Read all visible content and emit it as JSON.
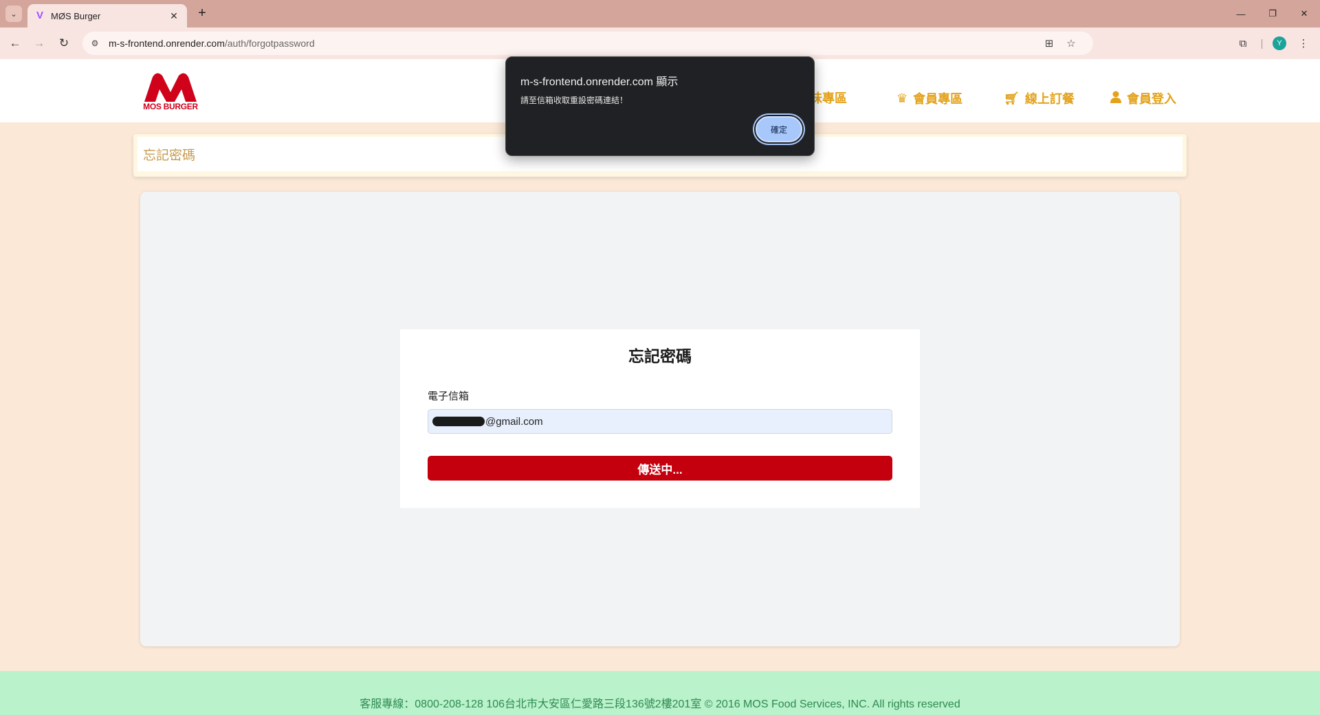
{
  "browser": {
    "tab_title": "MØS Burger",
    "new_tab": "+",
    "url_host": "m-s-frontend.onrender.com",
    "url_path": "/auth/forgotpassword",
    "profile_initial": "Y"
  },
  "site": {
    "logo_text": "MOS BURGER",
    "brand_color": "#d0021b",
    "accent_color": "#e3a21a",
    "nav": [
      {
        "label": "美味專區",
        "icon": "burger-icon"
      },
      {
        "label": "會員專區",
        "icon": "crown-icon"
      },
      {
        "label": "線上訂餐",
        "icon": "cart-icon"
      },
      {
        "label": "會員登入",
        "icon": "user-icon"
      }
    ]
  },
  "page": {
    "section_title": "忘記密碼",
    "form": {
      "title": "忘記密碼",
      "email_label": "電子信箱",
      "email_value_visible": "@gmail.com",
      "submit_label": "傳送中..."
    }
  },
  "footer": {
    "text": "客服專線：0800-208-128 106台北市大安區仁愛路三段136號2樓201室 © 2016 MOS Food Services, INC. All rights reserved"
  },
  "dialog": {
    "title": "m-s-frontend.onrender.com 顯示",
    "message": "請至信箱收取重設密碼連結！",
    "ok_label": "確定"
  }
}
